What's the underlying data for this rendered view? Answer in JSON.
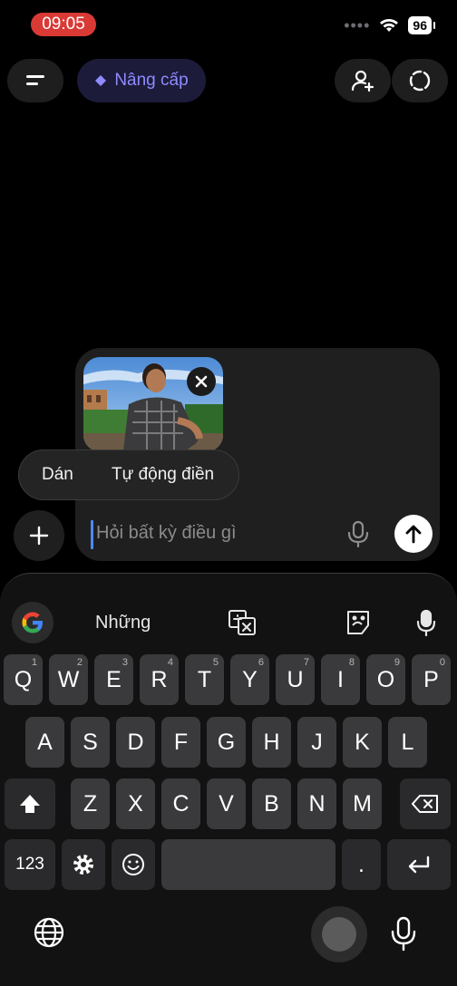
{
  "status": {
    "time": "09:05",
    "battery": "96"
  },
  "topbar": {
    "upgrade_label": "Nâng cấp"
  },
  "composer": {
    "placeholder": "Hỏi bất kỳ điều gì",
    "context_menu": [
      "Dán",
      "Tự động điền"
    ]
  },
  "keyboard": {
    "suggestion": "Những",
    "row1": [
      {
        "k": "Q",
        "h": "1"
      },
      {
        "k": "W",
        "h": "2"
      },
      {
        "k": "E",
        "h": "3"
      },
      {
        "k": "R",
        "h": "4"
      },
      {
        "k": "T",
        "h": "5"
      },
      {
        "k": "Y",
        "h": "6"
      },
      {
        "k": "U",
        "h": "7"
      },
      {
        "k": "I",
        "h": "8"
      },
      {
        "k": "O",
        "h": "9"
      },
      {
        "k": "P",
        "h": "0"
      }
    ],
    "row2": [
      "A",
      "S",
      "D",
      "F",
      "G",
      "H",
      "J",
      "K",
      "L"
    ],
    "row3": [
      "Z",
      "X",
      "C",
      "V",
      "B",
      "N",
      "M"
    ],
    "num_label": "123",
    "period": "."
  },
  "colors": {
    "accent": "#8f8bff",
    "recording": "#d93a36",
    "caret": "#4a8cff"
  }
}
